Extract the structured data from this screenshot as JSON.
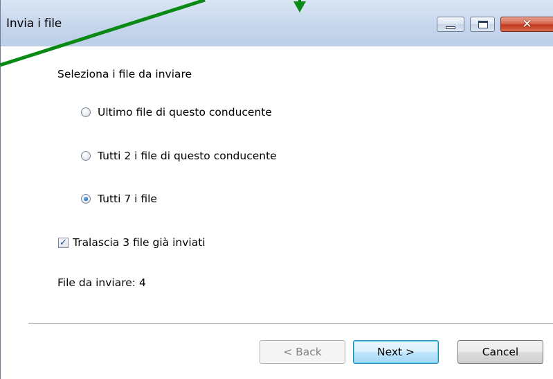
{
  "window": {
    "title": "Invia i file",
    "minimize_icon": "minimize-icon",
    "maximize_icon": "maximize-icon",
    "close_icon": "close-icon",
    "close_glyph": "✕"
  },
  "content": {
    "heading": "Seleziona i file da inviare",
    "options": [
      {
        "label": "Ultimo file di questo conducente",
        "selected": false
      },
      {
        "label": "Tutti 2 i file di  questo conducente",
        "selected": false
      },
      {
        "label": "Tutti 7 i file",
        "selected": true
      }
    ],
    "skip_checkbox": {
      "label": "Tralascia 3 file già inviati",
      "checked": true,
      "mark": "✓"
    },
    "summary": "File da inviare: 4"
  },
  "buttons": {
    "back": "< Back",
    "next": "Next >",
    "cancel": "Cancel"
  },
  "colors": {
    "annotation_arrow": "#0a8a14",
    "title_gradient_top": "#dbe6f4",
    "close_button": "#c4391f",
    "default_button_border": "#3c7fb1"
  }
}
